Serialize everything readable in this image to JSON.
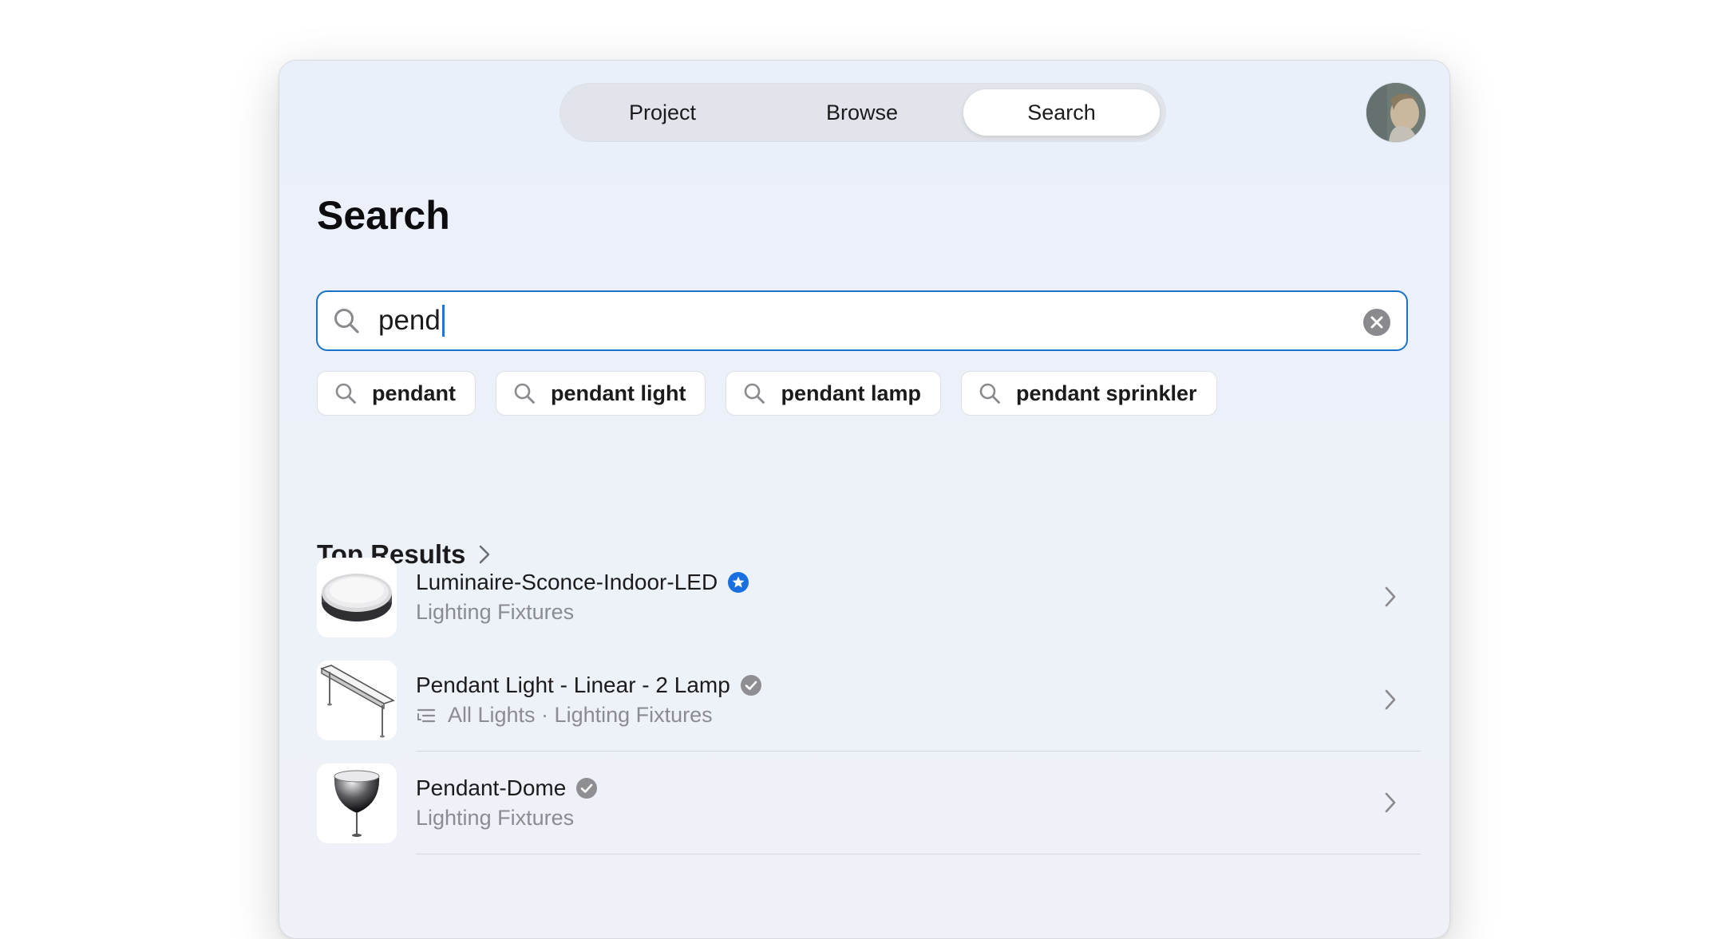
{
  "tabs": [
    {
      "label": "Project"
    },
    {
      "label": "Browse"
    },
    {
      "label": "Search"
    }
  ],
  "active_tab": "Search",
  "page": {
    "title": "Search"
  },
  "search": {
    "query": "pend"
  },
  "suggestions": [
    {
      "label": "pendant"
    },
    {
      "label": "pendant light"
    },
    {
      "label": "pendant lamp"
    },
    {
      "label": "pendant sprinkler"
    }
  ],
  "top_results": {
    "heading": "Top Results",
    "items": [
      {
        "title": "Luminaire-Sconce-Indoor-LED",
        "subtitle": "Lighting Fixtures",
        "badge": "star-badge-icon",
        "thumb": "round-sconce"
      },
      {
        "title": "Pendant Light - Linear - 2 Lamp",
        "subtitle": "All Lights · Lighting Fixtures",
        "badge": "verified-badge-icon",
        "thumb": "linear-pendant"
      },
      {
        "title": "Pendant-Dome",
        "subtitle": "Lighting Fixtures",
        "badge": "verified-badge-icon",
        "thumb": "dome-pendant"
      }
    ]
  },
  "colors": {
    "accent": "#1a73c8",
    "star_badge": "#1a6fe0",
    "verified_badge": "#8e8e93"
  }
}
